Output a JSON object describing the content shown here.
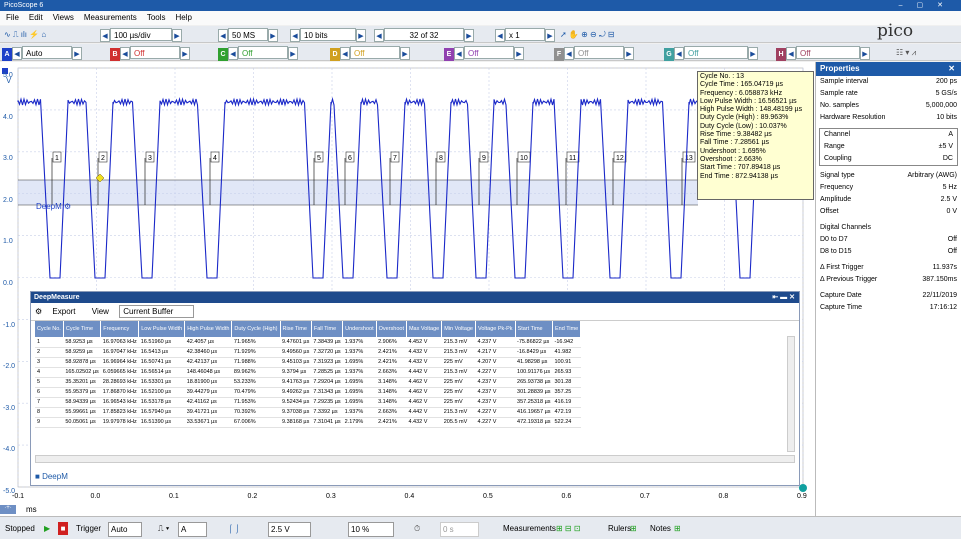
{
  "app": {
    "title": "PicoScope 6"
  },
  "menu": [
    "File",
    "Edit",
    "Views",
    "Measurements",
    "Tools",
    "Help"
  ],
  "toolbar": {
    "timebase": "100 µs/div",
    "samples": "50 MS",
    "resolution": "10 bits",
    "capture": "32 of 32",
    "zoom": "x 1",
    "logo": "pico"
  },
  "channels": [
    {
      "id": "A",
      "value": "Auto",
      "color": "#1e40c8"
    },
    {
      "id": "B",
      "value": "Off",
      "color": "#d03030"
    },
    {
      "id": "C",
      "value": "Off",
      "color": "#30a030"
    },
    {
      "id": "D",
      "value": "Off",
      "color": "#d0a020"
    },
    {
      "id": "E",
      "value": "Off",
      "color": "#9040b0"
    },
    {
      "id": "F",
      "value": "Off",
      "color": "#909090"
    },
    {
      "id": "G",
      "value": "Off",
      "color": "#40a0a0"
    },
    {
      "id": "H",
      "value": "Off",
      "color": "#a04060"
    }
  ],
  "yaxis": {
    "unit": "V",
    "labels": [
      "5.0",
      "4.0",
      "3.0",
      "2.0",
      "1.0",
      "0.0",
      "-1.0",
      "-2.0",
      "-3.0",
      "-4.0",
      "-5.0"
    ]
  },
  "xaxis": {
    "unit": "ms",
    "labels": [
      "-0.1",
      "0.0",
      "0.1",
      "0.2",
      "0.3",
      "0.4",
      "0.5",
      "0.6",
      "0.7",
      "0.8",
      "0.9"
    ]
  },
  "deep_marker": "DeepM",
  "cycle_markers": [
    "1",
    "2",
    "3",
    "4",
    "5",
    "6",
    "7",
    "8",
    "9",
    "10",
    "11",
    "12",
    "13"
  ],
  "tooltip": [
    "Cycle No. : 13",
    "Cycle Time : 165.04719 µs",
    "Frequency : 6.058873 kHz",
    "Low Pulse Width : 16.56521 µs",
    "High Pulse Width : 148.48199 µs",
    "Duty Cycle (High) : 89.963%",
    "Duty Cycle (Low) : 10.037%",
    "Rise Time : 9.38482 µs",
    "Fall Time : 7.28561 µs",
    "Undershoot : 1.695%",
    "Overshoot : 2.663%",
    "Start Time : 707.89418 µs",
    "End Time : 872.94138 µs"
  ],
  "deepmeasure": {
    "title": "DeepMeasure",
    "export": "Export",
    "view": "View",
    "buffer": "Current Buffer",
    "tab": "DeepM",
    "columns": [
      "Cycle No.",
      "Cycle Time",
      "Frequency",
      "Low Pulse Width",
      "High Pulse Width",
      "Duty Cycle (High)",
      "Rise Time",
      "Fall Time",
      "Undershoot",
      "Overshoot",
      "Max Voltage",
      "Min Voltage",
      "Voltage Pk-Pk",
      "Start Time",
      "End Time"
    ],
    "rows": [
      [
        "1",
        "58.9253 µs",
        "16.97063 kHz",
        "16.51960 µs",
        "42.4057 µs",
        "71.965%",
        "9.47601 µs",
        "7.38439 µs",
        "1.937%",
        "2.906%",
        "4.452 V",
        "215.3 mV",
        "4.237 V",
        "-75.86822 µs",
        "-16.942"
      ],
      [
        "2",
        "58.9259 µs",
        "16.97047 kHz",
        "16.5413 µs",
        "42.38460 µs",
        "71.929%",
        "9.49560 µs",
        "7.32720 µs",
        "1.937%",
        "2.421%",
        "4.432 V",
        "215.3 mV",
        "4.217 V",
        "-16.8429 µs",
        "41.982"
      ],
      [
        "3",
        "58.92878 µs",
        "16.96964 kHz",
        "16.50741 µs",
        "42.42137 µs",
        "71.988%",
        "9.45103 µs",
        "7.31923 µs",
        "1.695%",
        "2.421%",
        "4.432 V",
        "225 mV",
        "4.207 V",
        "41.98298 µs",
        "100.91"
      ],
      [
        "4",
        "165.02502 µs",
        "6.059665 kHz",
        "16.56514 µs",
        "148.46048 µs",
        "89.962%",
        "9.3794 µs",
        "7.28525 µs",
        "1.937%",
        "2.663%",
        "4.442 V",
        "215.3 mV",
        "4.227 V",
        "100.91176 µs",
        "265.93"
      ],
      [
        "5",
        "35.35201 µs",
        "28.28693 kHz",
        "16.53301 µs",
        "18.81900 µs",
        "53.233%",
        "9.41763 µs",
        "7.29204 µs",
        "1.695%",
        "3.148%",
        "4.462 V",
        "225 mV",
        "4.237 V",
        "265.93738 µs",
        "301.28"
      ],
      [
        "6",
        "55.95379 µs",
        "17.86870 kHz",
        "16.52100 µs",
        "39.44279 µs",
        "70.479%",
        "9.49262 µs",
        "7.31343 µs",
        "1.695%",
        "3.148%",
        "4.462 V",
        "225 mV",
        "4.237 V",
        "301.28839 µs",
        "357.25"
      ],
      [
        "7",
        "58.94339 µs",
        "16.96543 kHz",
        "16.53178 µs",
        "42.41162 µs",
        "71.953%",
        "9.52434 µs",
        "7.29235 µs",
        "1.695%",
        "3.148%",
        "4.462 V",
        "225 mV",
        "4.237 V",
        "357.25318 µs",
        "416.19"
      ],
      [
        "8",
        "55.99661 µs",
        "17.85823 kHz",
        "16.57940 µs",
        "39.41721 µs",
        "70.392%",
        "9.37038 µs",
        "7.3392 µs",
        "1.937%",
        "2.663%",
        "4.442 V",
        "215.3 mV",
        "4.227 V",
        "416.19657 µs",
        "472.19"
      ],
      [
        "9",
        "50.05061 µs",
        "19.97978 kHz",
        "16.51390 µs",
        "33.53671 µs",
        "67.006%",
        "9.38168 µs",
        "7.31041 µs",
        "2.179%",
        "2.421%",
        "4.432 V",
        "205.5 mV",
        "4.227 V",
        "472.19318 µs",
        "522.24"
      ]
    ]
  },
  "properties": {
    "title": "Properties",
    "top": [
      [
        "Sample interval",
        "200 ps"
      ],
      [
        "Sample rate",
        "5 GS/s"
      ],
      [
        "No. samples",
        "5,000,000"
      ],
      [
        "Hardware Resolution",
        "10 bits"
      ]
    ],
    "channel": [
      [
        "Channel",
        "A"
      ],
      [
        "Range",
        "±5 V"
      ],
      [
        "Coupling",
        "DC"
      ]
    ],
    "signal": [
      [
        "Signal type",
        "Arbitrary (AWG)"
      ],
      [
        "Frequency",
        "5 Hz"
      ],
      [
        "Amplitude",
        "2.5 V"
      ],
      [
        "Offset",
        "0 V"
      ]
    ],
    "digital_title": "Digital Channels",
    "digital": [
      [
        "D0 to D7",
        "Off"
      ],
      [
        "D8 to D15",
        "Off"
      ]
    ],
    "trigger": [
      [
        "Δ First Trigger",
        "11.937s"
      ],
      [
        "Δ Previous Trigger",
        "387.150ms"
      ]
    ],
    "capture": [
      [
        "Capture Date",
        "22/11/2019"
      ],
      [
        "Capture Time",
        "17:16:12"
      ]
    ]
  },
  "status": {
    "state": "Stopped",
    "trigger_label": "Trigger",
    "trigger_mode": "Auto",
    "trigger_channel": "A",
    "level": "2.5 V",
    "pretrigger": "10 %",
    "delay": "0 s",
    "measurements": "Measurements",
    "rulers": "Rulers",
    "notes": "Notes"
  }
}
